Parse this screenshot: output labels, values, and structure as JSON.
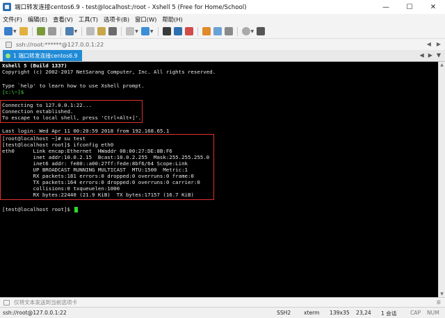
{
  "window": {
    "title": "端口转发连接centos6.9 - test@localhost:/root - Xshell 5 (Free for Home/School)",
    "min": "—",
    "max": "☐",
    "close": "✕"
  },
  "menu": {
    "items": [
      "文件(F)",
      "编辑(E)",
      "查看(V)",
      "工具(T)",
      "选项卡(B)",
      "窗口(W)",
      "帮助(H)"
    ]
  },
  "address": {
    "url": "ssh://root:******@127.0.0.1:22",
    "nav_left": "◀",
    "nav_right": "▶"
  },
  "tabs": {
    "active_label": "1 端口转发连接centos6.9",
    "prev": "◀",
    "next": "▶",
    "list": "▼"
  },
  "terminal": {
    "lines": [
      "Xshell 5 (Build 1337)",
      "Copyright (c) 2002-2017 NetSarang Computer, Inc. All rights reserved.",
      "",
      "Type `help' to learn how to use Xshell prompt.",
      "[c:\\~]$",
      "",
      "Connecting to 127.0.0.1:22...",
      "Connection established.",
      "To escape to local shell, press 'Ctrl+Alt+]'.",
      "",
      "Last login: Wed Apr 11 00:20:59 2018 from 192.168.65.1",
      "[root@localhost ~]# su test",
      "[test@localhost root]$ ifconfig eth0",
      "eth0      Link encap:Ethernet  HWaddr 08:00:27:DE:8B:F6",
      "          inet addr:10.0.2.15  Bcast:10.0.2.255  Mask:255.255.255.0",
      "          inet6 addr: fe80::a00:27ff:fede:8bf6/64 Scope:Link",
      "          UP BROADCAST RUNNING MULTICAST  MTU:1500  Metric:1",
      "          RX packets:181 errors:0 dropped:0 overruns:0 frame:0",
      "          TX packets:164 errors:0 dropped:0 overruns:0 carrier:0",
      "          collisions:0 txqueuelen:1000",
      "          RX bytes:22440 (21.9 KiB)  TX bytes:17157 (16.7 KiB)",
      "",
      "[test@localhost root]$ "
    ]
  },
  "sendbar": {
    "text": "仅将文本发送到当前选项卡",
    "menu": "☰"
  },
  "status": {
    "connection": "ssh://root@127.0.0.1:22",
    "protocol": "SSH2",
    "term": "xterm",
    "size": "139x35",
    "cursor": "23,24",
    "sessions": "1 会话",
    "cap": "CAP",
    "num": "NUM"
  },
  "colors": {
    "tab_active": "#1f8ad6",
    "terminal_bg": "#000000",
    "highlight": "#e03030",
    "cursor": "#2bdc2b"
  }
}
